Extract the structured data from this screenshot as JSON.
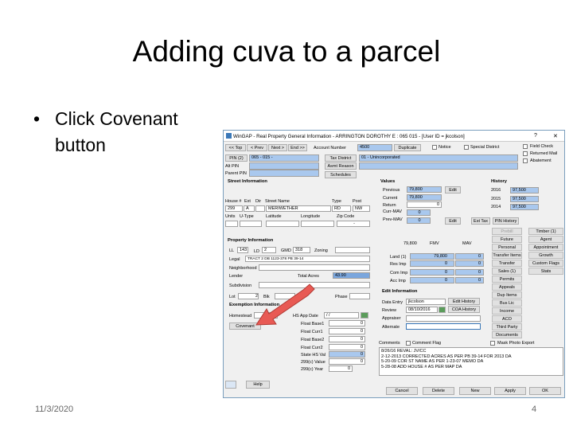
{
  "slide": {
    "title": "Adding cuva to a parcel",
    "bullet": "Click Covenant button",
    "bullet_mark": "•",
    "date": "11/3/2020",
    "page": "4"
  },
  "window": {
    "title": "WinGAP - Real Property General Information - ARRINGTON DOROTHY E : 065   015        - [User ID = jkcolson]",
    "help_q": "?",
    "close_x": "✕",
    "nav": {
      "top": "<< Top",
      "prev": "< Prev",
      "next": "Next >",
      "end": "End >>",
      "account_label": "Account Number",
      "account_value": "4500",
      "duplicate": "Duplicate",
      "notice": "Notice",
      "special_district": "Special District",
      "field_check": "Field Check",
      "returned_mail": "Returned Mail",
      "abatement": "Abatement"
    },
    "pin": {
      "pin2": "PIN (2)",
      "pin_value": "065 -  015 -",
      "alt_pin": "Alt PIN",
      "parent_pin": "Parent PIN",
      "tax_district": "Tax District",
      "tax_district_value": "01 - Unincorporated",
      "asmt_reason": "Asmt Reason",
      "schedules": "Schedules"
    },
    "street": {
      "header": "Street Information",
      "house_lbl": "House #",
      "ext_lbl": "Ext",
      "dir_lbl": "Dir",
      "street_lbl": "Street Name",
      "type_lbl": "Type",
      "post_lbl": "Post",
      "house": "299",
      "ext": "A",
      "street": "MERIWETHER",
      "type": "RD",
      "post": "NW",
      "units_lbl": "Units",
      "utype_lbl": "U-Type",
      "lat_lbl": "Latitude",
      "lon_lbl": "Longitude",
      "zip_lbl": "Zip Code",
      "zip": "-"
    },
    "property": {
      "header": "Property Information",
      "ll_lbl": "LL",
      "ll": "143",
      "ld_lbl": "LD",
      "ld": "2",
      "gmd_lbl": "GMD",
      "gmd": "318",
      "zoning_lbl": "Zoning",
      "legal_lbl": "Legal",
      "legal": "TRACT 2  DB 1123-378 PB 39-14",
      "neighborhood_lbl": "Neighborhood",
      "lender_lbl": "Lender",
      "total_acres_lbl": "Total Acres",
      "total_acres": "43.90",
      "subdivision_lbl": "Subdivision",
      "lot_lbl": "Lot",
      "lot": "2",
      "blk_lbl": "Blk",
      "phase_lbl": "Phase"
    },
    "exemption": {
      "header": "Exemption Information",
      "homestead_lbl": "Homestead",
      "covenant": "Covenant",
      "hs_app_date_lbl": "HS App Date",
      "hs_app_date": "/  /",
      "rows": [
        {
          "label": "Float Base1",
          "value": "0"
        },
        {
          "label": "Float Curr1",
          "value": "0"
        },
        {
          "label": "Float Base2",
          "value": "0"
        },
        {
          "label": "Float Curr2",
          "value": "0"
        },
        {
          "label": "State HS Val",
          "value": "0"
        },
        {
          "label": "299(c) Value",
          "value": "0"
        },
        {
          "label": "299(c) Year",
          "value": "0"
        }
      ]
    },
    "values": {
      "header": "Values",
      "previous_lbl": "Previous",
      "previous": "79,800",
      "current_lbl": "Current",
      "current": "79,800",
      "return_lbl": "Return",
      "return": "0",
      "curr_mav_lbl": "Curr-MAV",
      "curr_mav": "0",
      "prev_mav_lbl": "Prev-MAV",
      "prev_mav": "0",
      "edit1": "Edit",
      "edit2": "Edit",
      "esttax": "Est Tax",
      "pin_history": "PIN History"
    },
    "history": {
      "header": "History",
      "rows": [
        {
          "year": "2016",
          "value": "97,500"
        },
        {
          "year": "2015",
          "value": "97,500"
        },
        {
          "year": "2014",
          "value": "97,500"
        }
      ]
    },
    "right_buttons": [
      [
        "Prebill",
        "Timber (1)"
      ],
      [
        "Future",
        "Agent"
      ],
      [
        "Personal",
        "Appointment"
      ],
      [
        "Transfer Items",
        "Growth"
      ],
      [
        "Transfer",
        "Custom Flags"
      ],
      [
        "Sales (1)",
        "Stats"
      ],
      [
        "Permits",
        ""
      ],
      [
        "Appeals",
        ""
      ],
      [
        "Dup Items",
        ""
      ],
      [
        "Bus Lic",
        ""
      ],
      [
        "Income",
        ""
      ],
      [
        "ACO",
        ""
      ],
      [
        "Third Party",
        ""
      ],
      [
        "Documents",
        ""
      ]
    ],
    "fmv": {
      "top_value": "79,800",
      "fmv_hdr": "FMV",
      "mav_hdr": "MAV",
      "rows": [
        {
          "label": "Land (1)",
          "fmv": "79,800",
          "mav": "0"
        },
        {
          "label": "Res Imp",
          "fmv": "0",
          "mav": "0"
        },
        {
          "label": "Com Imp",
          "fmv": "0",
          "mav": "0"
        },
        {
          "label": "Acc Imp",
          "fmv": "0",
          "mav": "0"
        }
      ]
    },
    "edit_info": {
      "header": "Edit Information",
      "data_entry_lbl": "Data Entry",
      "data_entry": "jkcolson",
      "edit_history": "Edit History",
      "review_lbl": "Review",
      "review": "08/10/2016",
      "coa_history": "COA History",
      "appraiser_lbl": "Appraiser",
      "alternate_lbl": "Alternate"
    },
    "comments": {
      "label": "Comments",
      "comment_flag": "Comment Flag",
      "mask_photo": "Mask Photo Export",
      "lines": [
        "8/26/16  REVAL: JV/CC",
        "2-12-2013 CORRECTED ACRES AS PER PB 39-14 FOR 2013 DA",
        "5-20-09 COR  ST NAME AS PER 1-23-07 MEMO DA",
        "5-28-08 ADD HOUSE # AS PER MAP DA"
      ]
    },
    "bottom": {
      "help": "Help",
      "cancel": "Cancel",
      "delete": "Delete",
      "new": "New",
      "apply": "Apply",
      "ok": "OK"
    }
  }
}
